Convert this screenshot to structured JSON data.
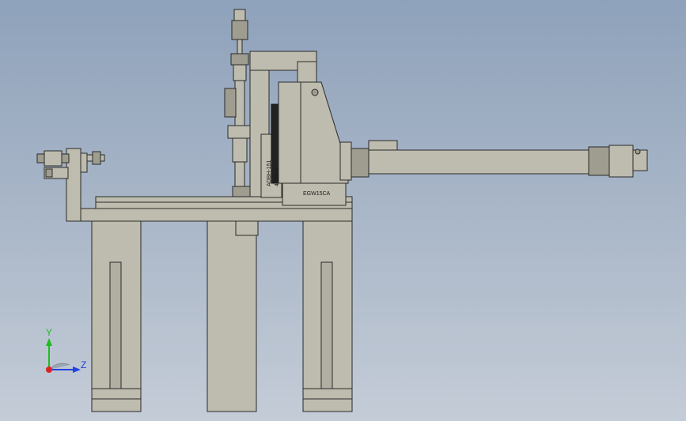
{
  "model": {
    "nameplate_label": "EGW15CA",
    "vertical_labels": [
      "ADBH-151",
      "4D5S-6"
    ]
  },
  "triad": {
    "y_label": "Y",
    "z_label": "Z",
    "y_color": "#22bb22",
    "z_color": "#2244dd",
    "x_color": "#dd2222"
  },
  "colors": {
    "background_top": "#8fa2bb",
    "background_bottom": "#c4ccd7",
    "part": "#bdbcae"
  }
}
